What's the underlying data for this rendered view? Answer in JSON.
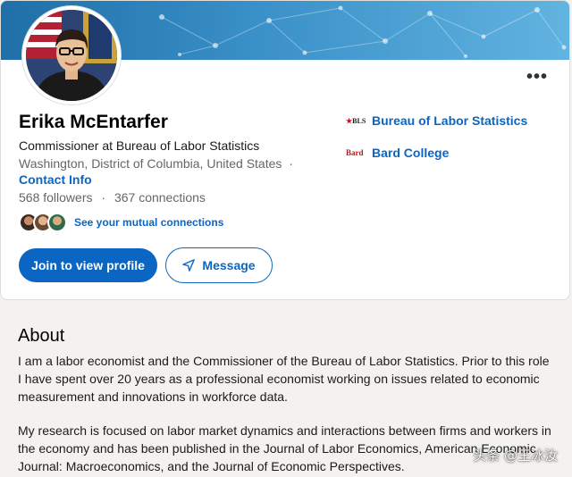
{
  "profile": {
    "name": "Erika McEntarfer",
    "headline": "Commissioner at Bureau of Labor Statistics",
    "location": "Washington, District of Columbia, United States",
    "location_sep": "·",
    "contact_label": "Contact Info",
    "followers": "568 followers",
    "stats_sep": "·",
    "connections": "367 connections",
    "mutual_label": "See your mutual connections",
    "more_label": "•••"
  },
  "actions": {
    "join_label": "Join to view profile",
    "message_label": "Message"
  },
  "orgs": [
    {
      "logo": "BLS",
      "name": "Bureau of Labor Statistics"
    },
    {
      "logo": "Bard",
      "name": "Bard College"
    }
  ],
  "about": {
    "title": "About",
    "p1": "I am a labor economist and the Commissioner of the Bureau of Labor Statistics. Prior to this role I have spent over 20 years as a professional economist working on issues related to economic measurement and innovations in workforce data.",
    "p2": "My research is focused on labor market dynamics and interactions between firms and workers in the economy and has been published in the Journal of Labor Economics, American Economic Journal: Macroeconomics, and the Journal of Economic Perspectives."
  },
  "watermark": "头条 @王冰汝",
  "colors": {
    "accent": "#0a66c2",
    "banner": "#3a90c8"
  }
}
